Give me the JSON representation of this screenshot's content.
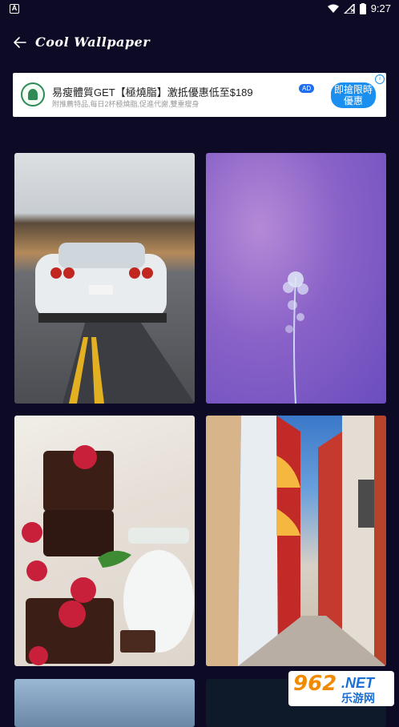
{
  "status_bar": {
    "left_icon": "a-icon",
    "time": "9:27"
  },
  "app_bar": {
    "title": "Cool Wallpaper"
  },
  "ad": {
    "title": "易瘦體質GET【極燒脂】激抵優惠低至$189",
    "subtitle": "附推薦特品,每日2杯極燒脂,促進代謝,雙重瘦身",
    "badge": "AD",
    "cta": "即搶限時優惠",
    "info": "i"
  },
  "wallpapers": [
    {
      "name": "car-road"
    },
    {
      "name": "purple-flower"
    },
    {
      "name": "chocolate-brownies"
    },
    {
      "name": "colorful-street"
    },
    {
      "name": "mountain-sky"
    },
    {
      "name": "night-stars"
    }
  ],
  "watermark": {
    "number": "962",
    "net": ".NET",
    "site": "乐游网"
  }
}
